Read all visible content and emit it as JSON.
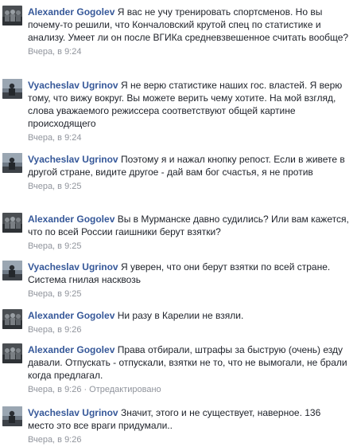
{
  "comments": [
    {
      "author": "Alexander Gogolev",
      "text": "Я вас не учу тренировать спортсменов. Но вы почему-то решили, что Кончаловский крутой спец по статистике и анализу. Умеет ли он после ВГИКа средневзвешенное считать вообще?",
      "time": "Вчера, в 9:24",
      "avatar": "gogolev"
    },
    {
      "author": "Vyacheslav Ugrinov",
      "text": "Я не верю статистике наших гос. властей. Я верю тому, что вижу вокруг. Вы можете верить чему хотите. На мой взгляд, слова уважаемого режиссера соответствуют общей картине происходящего",
      "time": "Вчера, в 9:24",
      "avatar": "ugrinov"
    },
    {
      "author": "Vyacheslav Ugrinov",
      "text": "Поэтому я и нажал кнопку репост. Если в живете в другой стране, видите другое - дай вам бог счастья, я не против",
      "time": "Вчера, в 9:25",
      "avatar": "ugrinov"
    },
    {
      "author": "Alexander Gogolev",
      "text": "Вы в Мурманске давно судились? Или вам кажется, что по всей России гаишники берут взятки?",
      "time": "Вчера, в 9:25",
      "avatar": "gogolev"
    },
    {
      "author": "Vyacheslav Ugrinov",
      "text": "Я уверен, что они берут взятки по всей стране. Система гнилая насквозь",
      "time": "Вчера, в 9:25",
      "avatar": "ugrinov"
    },
    {
      "author": "Alexander Gogolev",
      "text": "Ни разу в Карелии не взяли.",
      "time": "Вчера, в 9:26",
      "avatar": "gogolev"
    },
    {
      "author": "Alexander Gogolev",
      "text": "Права отбирали, штрафы за быструю (очень) езду давали. Отпускать - отпускали, взятки не то, что не вымогали, не брали когда предлагал.",
      "time": "Вчера, в 9:26",
      "edited": "Отредактировано",
      "avatar": "gogolev"
    },
    {
      "author": "Vyacheslav Ugrinov",
      "text": "Значит, этого и не существует, наверное. 136 место это все враги придумали..",
      "time": "Вчера, в 9:26",
      "avatar": "ugrinov"
    }
  ],
  "colors": {
    "author": "#365899",
    "text": "#1d2129",
    "meta": "#90949c"
  }
}
